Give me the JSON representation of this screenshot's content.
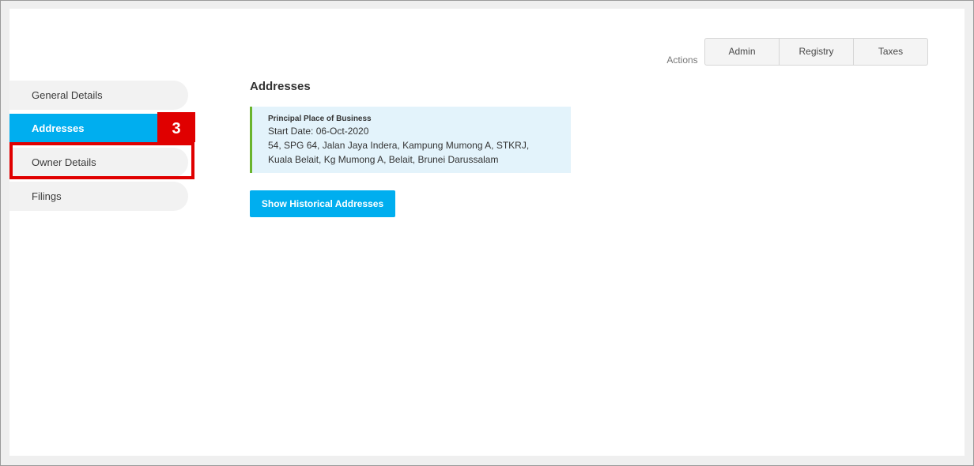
{
  "actions": {
    "label": "Actions",
    "buttons": [
      {
        "label": "Admin"
      },
      {
        "label": "Registry"
      },
      {
        "label": "Taxes"
      }
    ]
  },
  "sidebar": {
    "items": [
      {
        "label": "General Details"
      },
      {
        "label": "Addresses"
      },
      {
        "label": "Owner Details"
      },
      {
        "label": "Filings"
      }
    ],
    "active": "Addresses"
  },
  "annotation": {
    "step": "3"
  },
  "main": {
    "title": "Addresses",
    "address": {
      "type": "Principal Place of Business",
      "start_date": "Start Date: 06-Oct-2020",
      "line1": "54, SPG 64, Jalan Jaya Indera, Kampung Mumong A, STKRJ,",
      "line2": "Kuala Belait, Kg Mumong A, Belait, Brunei Darussalam"
    },
    "history_button": "Show Historical Addresses"
  },
  "colors": {
    "accent": "#00aeef",
    "highlight": "#e00000",
    "card_border": "#6ab42d",
    "card_bg": "#e3f3fb"
  }
}
